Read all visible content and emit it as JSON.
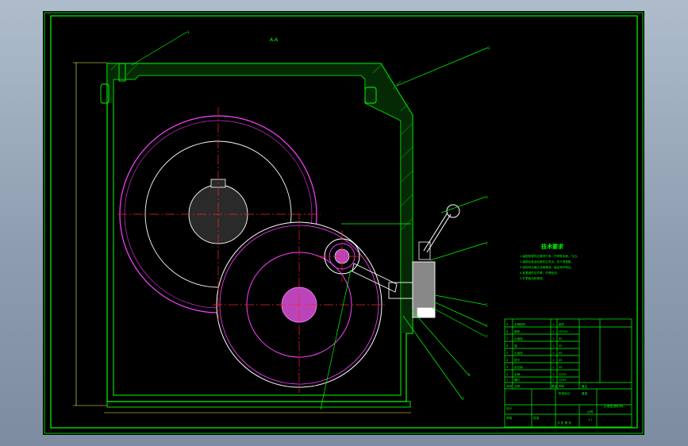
{
  "drawing": {
    "section_label": "A-A",
    "technical_requirements": {
      "title": "技术要求",
      "items": [
        "1.装配前零件应清洗干净，不得有毛刺、飞边。",
        "2.装配后各运动部件应灵活，无卡滞现象。",
        "3.齿轮啮合面应涂润滑油，保证良好啮合。",
        "4.各紧固件应拧紧，不得松动。",
        "5.外表面涂防锈漆。"
      ]
    },
    "parts_list": [
      {
        "no": "9",
        "name": "手柄组件",
        "qty": "1",
        "material": "组件",
        "note": ""
      },
      {
        "no": "8",
        "name": "箱体",
        "qty": "1",
        "material": "HT200",
        "note": ""
      },
      {
        "no": "7",
        "name": "大齿轮",
        "qty": "1",
        "material": "45",
        "note": ""
      },
      {
        "no": "6",
        "name": "轴",
        "qty": "1",
        "material": "45",
        "note": ""
      },
      {
        "no": "5",
        "name": "小齿轮",
        "qty": "1",
        "material": "45",
        "note": ""
      },
      {
        "no": "4",
        "name": "拨叉",
        "qty": "1",
        "material": "45",
        "note": ""
      },
      {
        "no": "3",
        "name": "定位销",
        "qty": "1",
        "material": "35",
        "note": ""
      },
      {
        "no": "2",
        "name": "手柄",
        "qty": "1",
        "material": "Q235",
        "note": ""
      },
      {
        "no": "1",
        "name": "螺钉",
        "qty": "2",
        "material": "Q235",
        "note": ""
      }
    ],
    "parts_header": {
      "no": "序号",
      "name": "名称",
      "qty": "数量",
      "material": "材料",
      "note": "备注"
    },
    "title_block": {
      "drawing_title": "主轴变速机构",
      "material_cell": "",
      "designer_label": "设计",
      "checker_label": "审核",
      "approver_label": "批准",
      "scale_label": "比例",
      "scale_value": "1:1",
      "sheet_label": "共 张 第 张",
      "weight_label": "重量",
      "stage_label": "阶段标记"
    },
    "dimensions": {
      "height_label": "",
      "leader_tags": [
        "1",
        "2",
        "3",
        "4",
        "5",
        "6",
        "7",
        "8",
        "9"
      ]
    },
    "colors": {
      "paper": "#000000",
      "frame": "#00c800",
      "outline": "#00ff00",
      "gear": "#ff40ff",
      "centerline": "#ff2020",
      "leader": "#00ff00",
      "dimension": "#ffff55",
      "text": "#00ff00",
      "white": "#ffffff"
    }
  }
}
